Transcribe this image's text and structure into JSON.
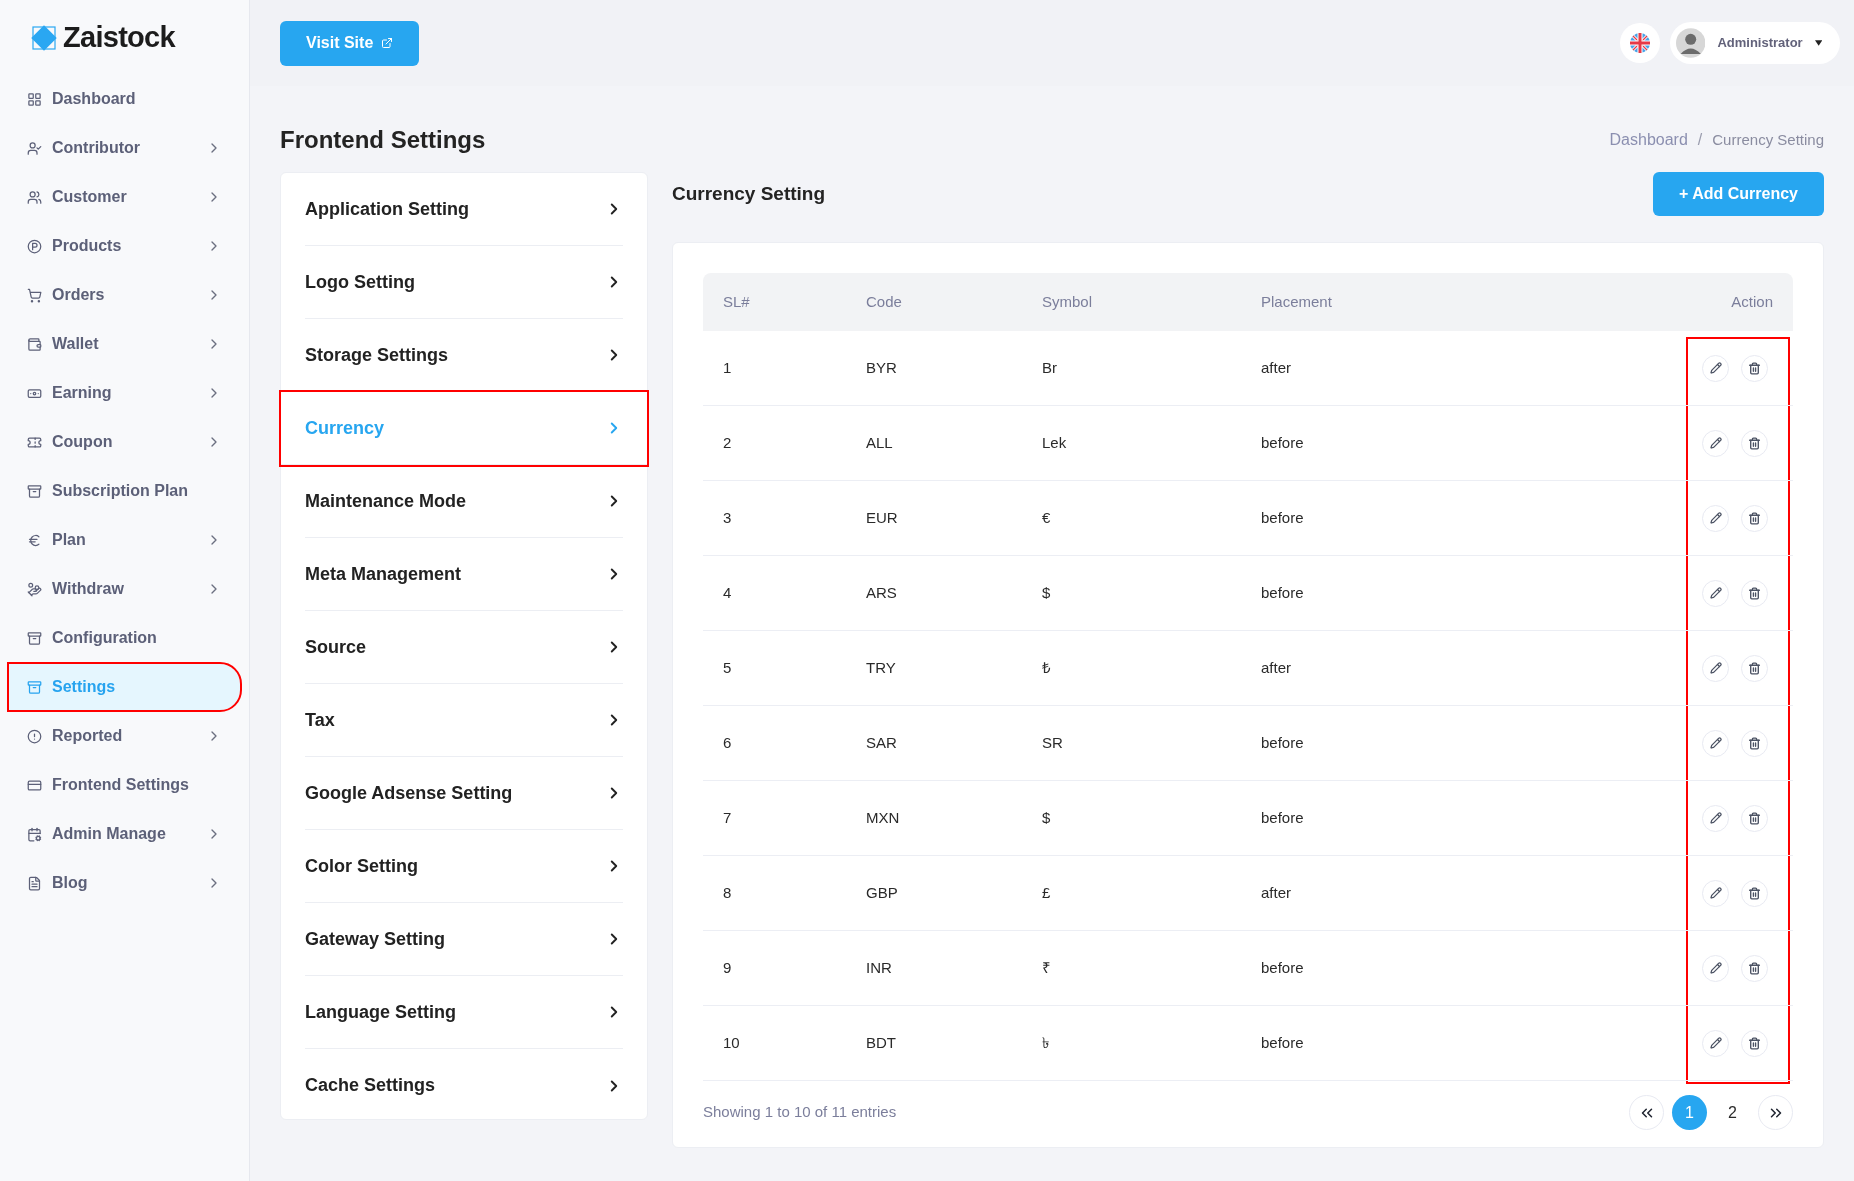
{
  "brand": {
    "name": "Zaistock"
  },
  "sidebar": {
    "items": [
      {
        "label": "Dashboard",
        "expandable": false,
        "selected": false,
        "highlighted": false
      },
      {
        "label": "Contributor",
        "expandable": true,
        "selected": false,
        "highlighted": false
      },
      {
        "label": "Customer",
        "expandable": true,
        "selected": false,
        "highlighted": false
      },
      {
        "label": "Products",
        "expandable": true,
        "selected": false,
        "highlighted": false
      },
      {
        "label": "Orders",
        "expandable": true,
        "selected": false,
        "highlighted": false
      },
      {
        "label": "Wallet",
        "expandable": true,
        "selected": false,
        "highlighted": false
      },
      {
        "label": "Earning",
        "expandable": true,
        "selected": false,
        "highlighted": false
      },
      {
        "label": "Coupon",
        "expandable": true,
        "selected": false,
        "highlighted": false
      },
      {
        "label": "Subscription Plan",
        "expandable": false,
        "selected": false,
        "highlighted": false
      },
      {
        "label": "Plan",
        "expandable": true,
        "selected": false,
        "highlighted": false
      },
      {
        "label": "Withdraw",
        "expandable": true,
        "selected": false,
        "highlighted": false
      },
      {
        "label": "Configuration",
        "expandable": false,
        "selected": false,
        "highlighted": false
      },
      {
        "label": "Settings",
        "expandable": false,
        "selected": true,
        "highlighted": true
      },
      {
        "label": "Reported",
        "expandable": true,
        "selected": false,
        "highlighted": false
      },
      {
        "label": "Frontend Settings",
        "expandable": false,
        "selected": false,
        "highlighted": false
      },
      {
        "label": "Admin Manage",
        "expandable": true,
        "selected": false,
        "highlighted": false
      },
      {
        "label": "Blog",
        "expandable": true,
        "selected": false,
        "highlighted": false
      }
    ]
  },
  "topbar": {
    "visit_button": "Visit Site",
    "user": "Administrator"
  },
  "page": {
    "title": "Frontend Settings",
    "breadcrumb": [
      "Dashboard",
      "Currency Setting"
    ],
    "breadcrumb_separator": "/"
  },
  "settings_menu": [
    {
      "label": "Application Setting",
      "selected": false,
      "highlighted": false
    },
    {
      "label": "Logo Setting",
      "selected": false,
      "highlighted": false
    },
    {
      "label": "Storage Settings",
      "selected": false,
      "highlighted": false
    },
    {
      "label": "Currency",
      "selected": true,
      "highlighted": true
    },
    {
      "label": "Maintenance Mode",
      "selected": false,
      "highlighted": false
    },
    {
      "label": "Meta Management",
      "selected": false,
      "highlighted": false
    },
    {
      "label": "Source",
      "selected": false,
      "highlighted": false
    },
    {
      "label": "Tax",
      "selected": false,
      "highlighted": false
    },
    {
      "label": "Google Adsense Setting",
      "selected": false,
      "highlighted": false
    },
    {
      "label": "Color Setting",
      "selected": false,
      "highlighted": false
    },
    {
      "label": "Gateway Setting",
      "selected": false,
      "highlighted": false
    },
    {
      "label": "Language Setting",
      "selected": false,
      "highlighted": false
    },
    {
      "label": "Cache Settings",
      "selected": false,
      "highlighted": false
    }
  ],
  "currency": {
    "title": "Currency Setting",
    "add_button": "+ Add Currency",
    "table": {
      "columns": [
        "SL#",
        "Code",
        "Symbol",
        "Placement",
        "Action"
      ],
      "actions_highlighted": true,
      "rows": [
        [
          "1",
          "BYR",
          "Br",
          "after"
        ],
        [
          "2",
          "ALL",
          "Lek",
          "before"
        ],
        [
          "3",
          "EUR",
          "€",
          "before"
        ],
        [
          "4",
          "ARS",
          "$",
          "before"
        ],
        [
          "5",
          "TRY",
          "₺",
          "after"
        ],
        [
          "6",
          "SAR",
          "SR",
          "before"
        ],
        [
          "7",
          "MXN",
          "$",
          "before"
        ],
        [
          "8",
          "GBP",
          "£",
          "after"
        ],
        [
          "9",
          "INR",
          "₹",
          "before"
        ],
        [
          "10",
          "BDT",
          "৳",
          "before"
        ]
      ]
    },
    "footer": "Showing 1 to 10 of 11 entries",
    "pages": [
      {
        "label": "1",
        "selected": true
      },
      {
        "label": "2",
        "selected": false
      }
    ]
  }
}
